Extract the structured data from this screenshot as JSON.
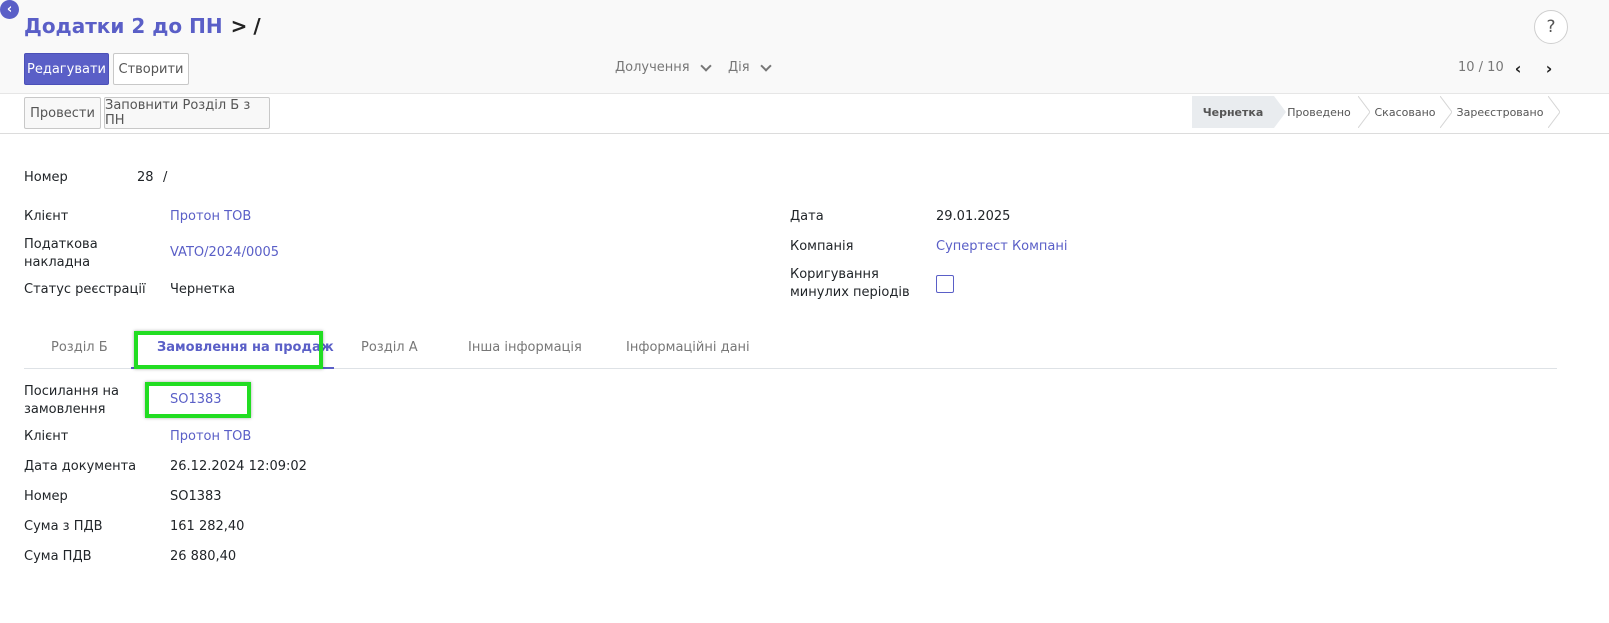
{
  "header": {
    "breadcrumb_parent": "Додатки 2 до ПН",
    "breadcrumb_separator": ">",
    "breadcrumb_current": "/",
    "help_label": "?"
  },
  "toolbar": {
    "edit_label": "Редагувати",
    "create_label": "Створити",
    "attach_label": "Долучення",
    "action_label": "Дія",
    "pager": "10 / 10"
  },
  "statusbar": {
    "post_label": "Провести",
    "fill_label": "Заповнити Розділ Б з ПН",
    "stages": [
      {
        "label": "Чернетка",
        "active": true
      },
      {
        "label": "Проведено",
        "active": false
      },
      {
        "label": "Скасовано",
        "active": false
      },
      {
        "label": "Зареєстровано",
        "active": false
      }
    ]
  },
  "form": {
    "number_label": "Номер",
    "number_value": "28",
    "number_suffix": "/",
    "client_label": "Клієнт",
    "client_value": "Протон ТОВ",
    "tax_invoice_label_1": "Податкова",
    "tax_invoice_label_2": "накладна",
    "tax_invoice_value": "VATO/2024/0005",
    "reg_status_label": "Статус реєстрації",
    "reg_status_value": "Чернетка",
    "date_label": "Дата",
    "date_value": "29.01.2025",
    "company_label": "Компанія",
    "company_value": "Супертест Компані",
    "correction_label_1": "Коригування",
    "correction_label_2": "минулих періодів",
    "correction_checked": false
  },
  "tabs": [
    {
      "label": "Розділ Б",
      "active": false
    },
    {
      "label": "Замовлення на продаж",
      "active": true
    },
    {
      "label": "Розділ А",
      "active": false
    },
    {
      "label": "Інша інформація",
      "active": false
    },
    {
      "label": "Інформаційні дані",
      "active": false
    }
  ],
  "order_tab": {
    "ref_label_1": "Посилання на",
    "ref_label_2": "замовлення",
    "ref_value": "SO1383",
    "client_label": "Клієнт",
    "client_value": "Протон ТОВ",
    "doc_date_label": "Дата документа",
    "doc_date_value": "26.12.2024 12:09:02",
    "number_label": "Номер",
    "number_value": "SO1383",
    "total_label": "Сума з ПДВ",
    "total_value": "161 282,40",
    "vat_label": "Сума ПДВ",
    "vat_value": "26 880,40"
  },
  "colors": {
    "accent": "#5a5fc7",
    "highlight": "#22dd22"
  }
}
